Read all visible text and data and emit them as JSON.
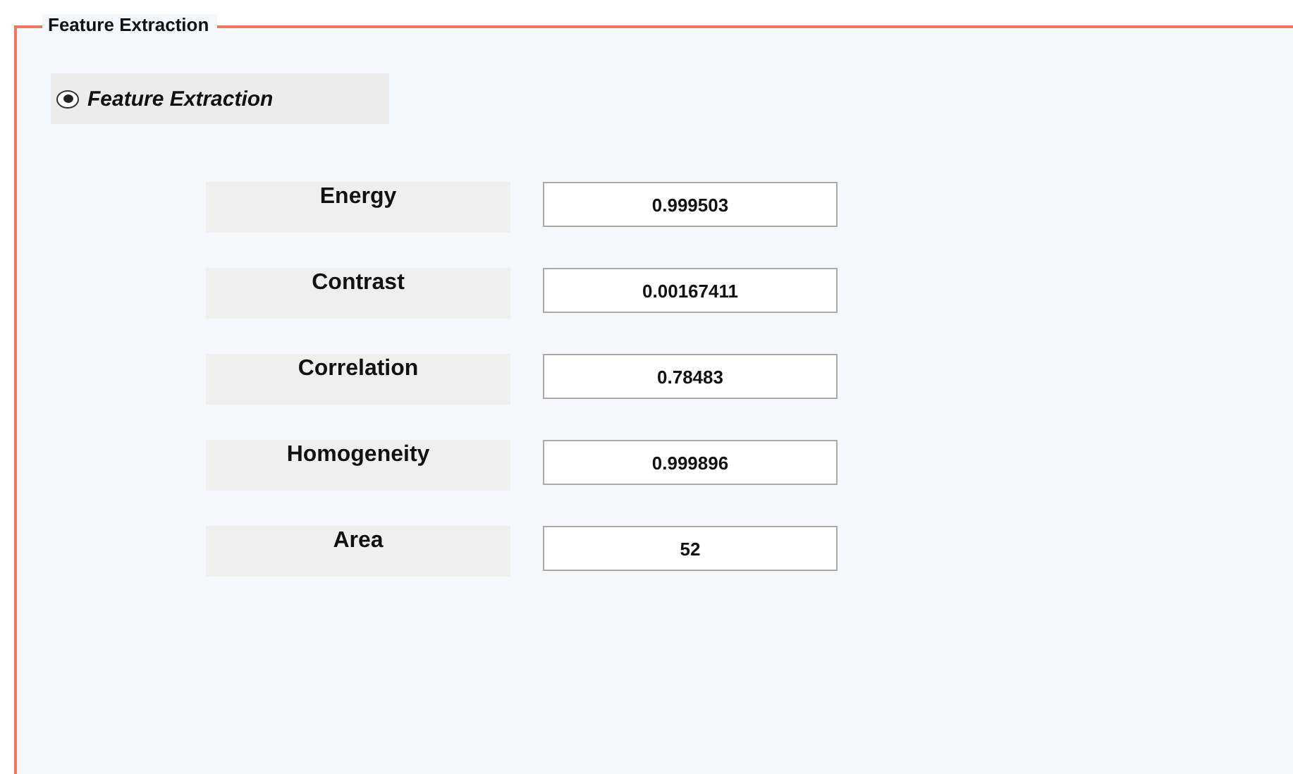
{
  "panel": {
    "title": "Feature Extraction"
  },
  "radio": {
    "label": "Feature Extraction",
    "selected": true
  },
  "features": [
    {
      "label": "Energy",
      "value": "0.999503"
    },
    {
      "label": "Contrast",
      "value": "0.00167411"
    },
    {
      "label": "Correlation",
      "value": "0.78483"
    },
    {
      "label": "Homogeneity",
      "value": "0.999896"
    },
    {
      "label": "Area",
      "value": "52"
    }
  ]
}
